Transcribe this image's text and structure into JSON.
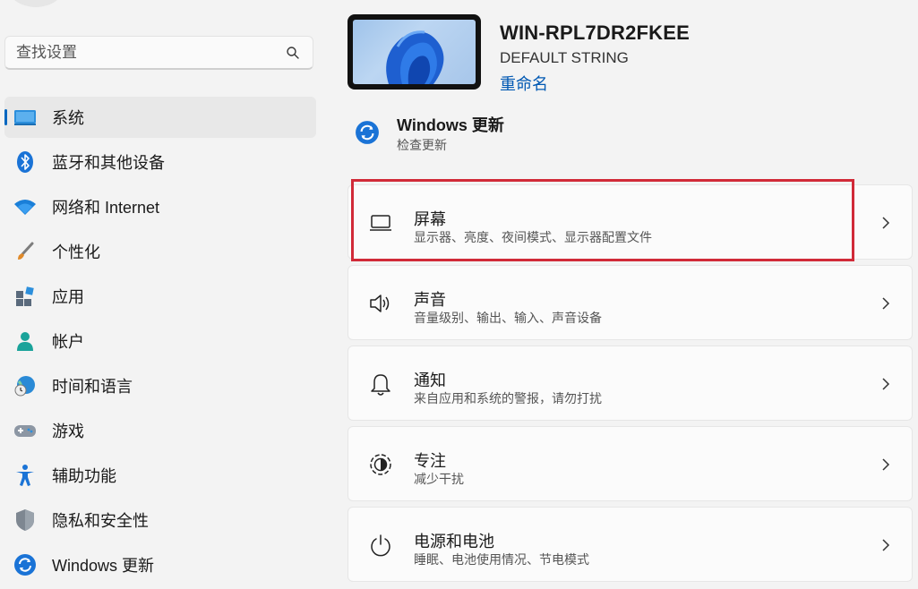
{
  "search": {
    "placeholder": "查找设置"
  },
  "sidebar": {
    "items": [
      {
        "label": "系统",
        "icon": "monitor-icon",
        "selected": true
      },
      {
        "label": "蓝牙和其他设备",
        "icon": "bluetooth-icon"
      },
      {
        "label": "网络和 Internet",
        "icon": "wifi-icon"
      },
      {
        "label": "个性化",
        "icon": "paintbrush-icon"
      },
      {
        "label": "应用",
        "icon": "apps-icon"
      },
      {
        "label": "帐户",
        "icon": "person-icon"
      },
      {
        "label": "时间和语言",
        "icon": "globe-clock-icon"
      },
      {
        "label": "游戏",
        "icon": "gamepad-icon"
      },
      {
        "label": "辅助功能",
        "icon": "accessibility-icon"
      },
      {
        "label": "隐私和安全性",
        "icon": "shield-icon"
      },
      {
        "label": "Windows 更新",
        "icon": "sync-icon"
      }
    ]
  },
  "device": {
    "name": "WIN-RPL7DR2FKEE",
    "model": "DEFAULT STRING",
    "rename_label": "重命名"
  },
  "update": {
    "title": "Windows 更新",
    "subtitle": "检查更新"
  },
  "cards": [
    {
      "title": "屏幕",
      "subtitle": "显示器、亮度、夜间模式、显示器配置文件",
      "icon": "display-icon",
      "highlighted": true
    },
    {
      "title": "声音",
      "subtitle": "音量级别、输出、输入、声音设备",
      "icon": "speaker-icon"
    },
    {
      "title": "通知",
      "subtitle": "来自应用和系统的警报，请勿打扰",
      "icon": "bell-icon"
    },
    {
      "title": "专注",
      "subtitle": "减少干扰",
      "icon": "focus-icon"
    },
    {
      "title": "电源和电池",
      "subtitle": "睡眠、电池使用情况、节电模式",
      "icon": "power-icon"
    }
  ],
  "colors": {
    "accent": "#0067c0",
    "highlight": "#d12a38",
    "link": "#0058b3"
  }
}
